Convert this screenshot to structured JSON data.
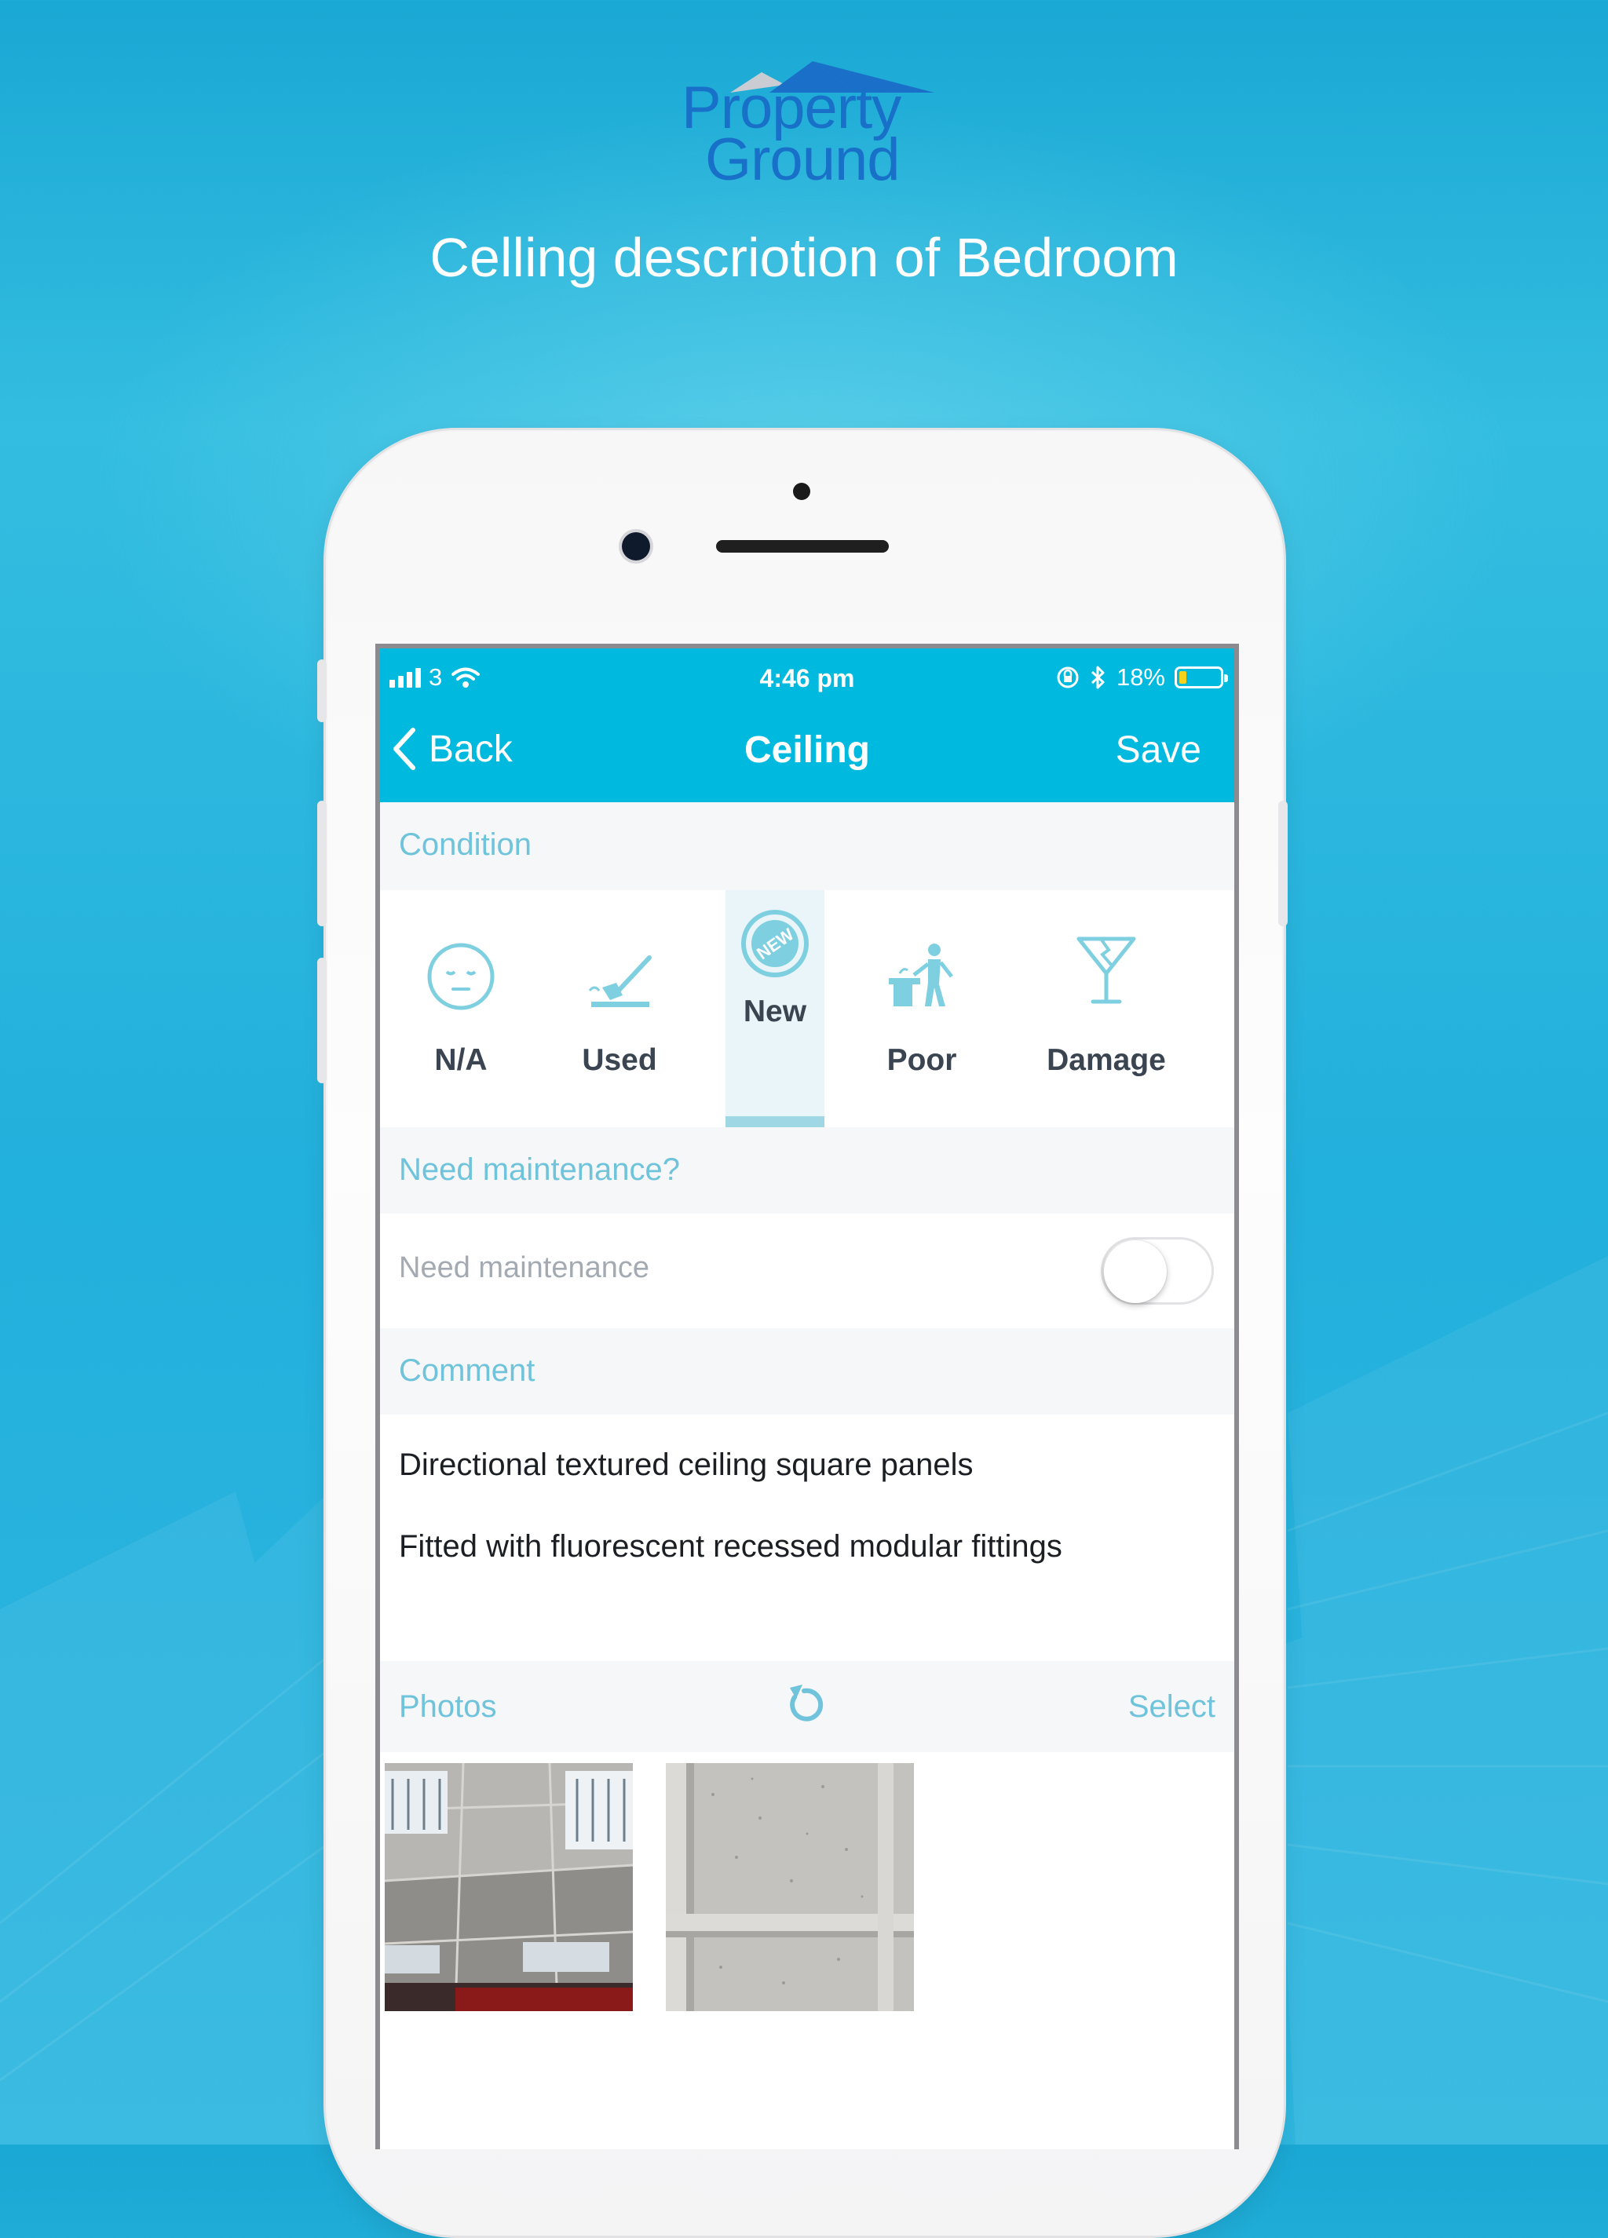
{
  "brand": {
    "line1": "Property",
    "line2": "Ground"
  },
  "headline": "Celling descriotion of Bedroom",
  "status_bar": {
    "carrier": "3",
    "time": "4:46 pm",
    "battery": "18%",
    "battery_level": 0.18
  },
  "nav": {
    "back_label": "Back",
    "title": "Ceiling",
    "save_label": "Save"
  },
  "condition": {
    "header": "Condition",
    "options": [
      {
        "label": "N/A",
        "icon": "sleepy-face-icon"
      },
      {
        "label": "Used",
        "icon": "broom-icon"
      },
      {
        "label": "New",
        "icon": "new-badge-icon"
      },
      {
        "label": "Poor",
        "icon": "person-at-desk-icon"
      },
      {
        "label": "Damage",
        "icon": "broken-glass-icon"
      }
    ],
    "selected": "New"
  },
  "maintenance": {
    "header": "Need maintenance?",
    "label": "Need maintenance",
    "enabled": false
  },
  "comment": {
    "header": "Comment",
    "lines": [
      "Directional textured ceiling square panels",
      "Fitted with fluorescent recessed modular fittings"
    ]
  },
  "photos": {
    "header": "Photos",
    "select_label": "Select",
    "count": 2
  },
  "colors": {
    "accent": "#00b9de",
    "section_text": "#6fc3da",
    "background": "#2ab4dd"
  }
}
